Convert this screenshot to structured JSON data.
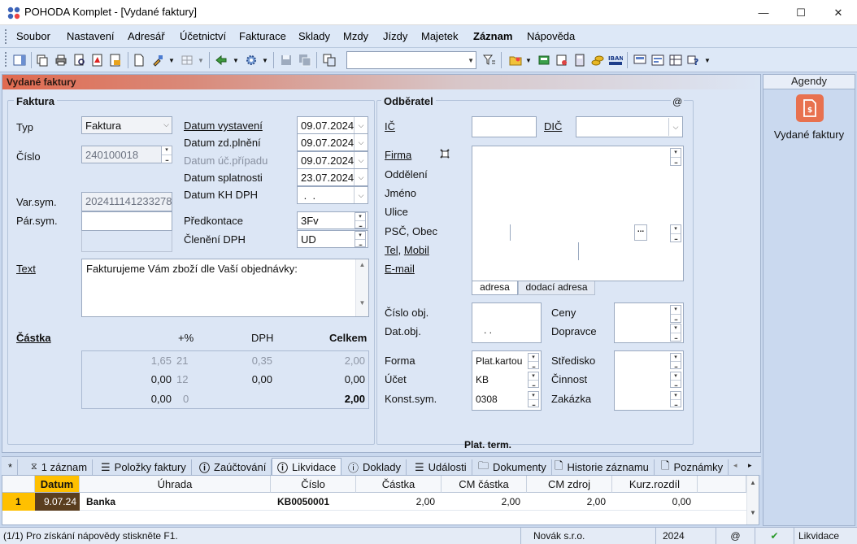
{
  "window": {
    "title": "POHODA Komplet - [Vydané faktury]",
    "minimize": "—",
    "maximize": "☐",
    "close": "✕"
  },
  "menu": [
    "Soubor",
    "Nastavení",
    "Adresář",
    "Účetnictví",
    "Fakturace",
    "Sklady",
    "Mzdy",
    "Jízdy",
    "Majetek",
    "Záznam",
    "Nápověda"
  ],
  "toolbar": {
    "search_value": ""
  },
  "document": {
    "title": "Vydané faktury",
    "faktura": {
      "group_title": "Faktura",
      "typ_label": "Typ",
      "typ_value": "Faktura",
      "cislo_label": "Číslo",
      "cislo_value": "240100018",
      "varsym_label": "Var.sym.",
      "varsym_value": "202411141233278",
      "parsym_label": "Pár.sym.",
      "parsym_value": "",
      "text_label": "Text",
      "text_value": "Fakturujeme Vám zboží dle Vaší objednávky:"
    },
    "dates": {
      "vystaveni_label": "Datum vystavení",
      "vystaveni_value": "09.07.2024",
      "zdplneni_label": "Datum zd.plnění",
      "zdplneni_value": "09.07.2024",
      "ucprip_label": "Datum úč.případu",
      "ucprip_value": "09.07.2024",
      "splatnosti_label": "Datum splatnosti",
      "splatnosti_value": "23.07.2024",
      "khdph_label": "Datum KH DPH",
      "khdph_value": " .  ."
    },
    "predkontace_label": "Předkontace",
    "predkontace_value": "3Fv",
    "cleneni_label": "Členění DPH",
    "cleneni_value": "UD",
    "castka": {
      "label": "Částka",
      "col_pct": "+%",
      "col_dph": "DPH",
      "col_celkem": "Celkem",
      "rows": [
        {
          "zaklad": "1,65",
          "pct": "21",
          "dph": "0,35",
          "celkem": "2,00"
        },
        {
          "zaklad": "0,00",
          "pct": "12",
          "dph": "0,00",
          "celkem": "0,00"
        },
        {
          "zaklad": "0,00",
          "pct": "0",
          "dph": "",
          "celkem": "2,00"
        }
      ]
    },
    "odberatel": {
      "group_title": "Odběratel",
      "at_label": "@",
      "ic_label": "IČ",
      "ic_value": "",
      "dic_label": "DIČ",
      "dic_value": "",
      "firma_label": "Firma",
      "oddeleni_label": "Oddělení",
      "jmeno_label": "Jméno",
      "ulice_label": "Ulice",
      "psc_label": "PSČ, Obec",
      "tel_label": "Tel",
      "mobil_label": "Mobil",
      "email_label": "E-mail",
      "tab_adresa": "adresa",
      "tab_dodaci": "dodací adresa",
      "ellipsis": "..."
    },
    "objednavka": {
      "cislo_obj_label": "Číslo obj.",
      "dat_obj_label": "Dat.obj.",
      "dat_obj_value": ".  .",
      "ceny_label": "Ceny",
      "dopravce_label": "Dopravce"
    },
    "platba": {
      "forma_label": "Forma",
      "forma_value": "Plat.kartou",
      "ucet_label": "Účet",
      "ucet_value": "KB",
      "konstsym_label": "Konst.sym.",
      "konstsym_value": "0308",
      "stredisko_label": "Středisko",
      "cinnost_label": "Činnost",
      "zakazka_label": "Zakázka"
    },
    "plat_term": "Plat. term."
  },
  "tabs": [
    {
      "label": "*"
    },
    {
      "label": "1 záznam"
    },
    {
      "label": "Položky faktury"
    },
    {
      "label": "Zaúčtování"
    },
    {
      "label": "Likvidace"
    },
    {
      "label": "Doklady"
    },
    {
      "label": "Události"
    },
    {
      "label": "Dokumenty"
    },
    {
      "label": "Historie záznamu"
    },
    {
      "label": "Poznámky"
    }
  ],
  "grid": {
    "headers": [
      "Datum",
      "Úhrada",
      "Číslo",
      "Částka",
      "CM částka",
      "CM zdroj",
      "Kurz.rozdíl"
    ],
    "rows": [
      {
        "index": "1",
        "datum": "9.07.24",
        "uhrada": "Banka",
        "cislo": "KB0050001",
        "castka": "2,00",
        "cm_castka": "2,00",
        "cm_zdroj": "2,00",
        "kurz": "0,00"
      }
    ]
  },
  "status": {
    "help": "(1/1) Pro získání nápovědy stiskněte F1.",
    "company": "Novák s.r.o.",
    "year": "2024",
    "at": "@",
    "mode": "Likvidace"
  },
  "agendy": {
    "title": "Agendy",
    "item_label": "Vydané faktury"
  },
  "colors": {
    "accent": "#e8714f",
    "panel_bg": "#dce6f5",
    "grid_selected": "#ffc000"
  }
}
